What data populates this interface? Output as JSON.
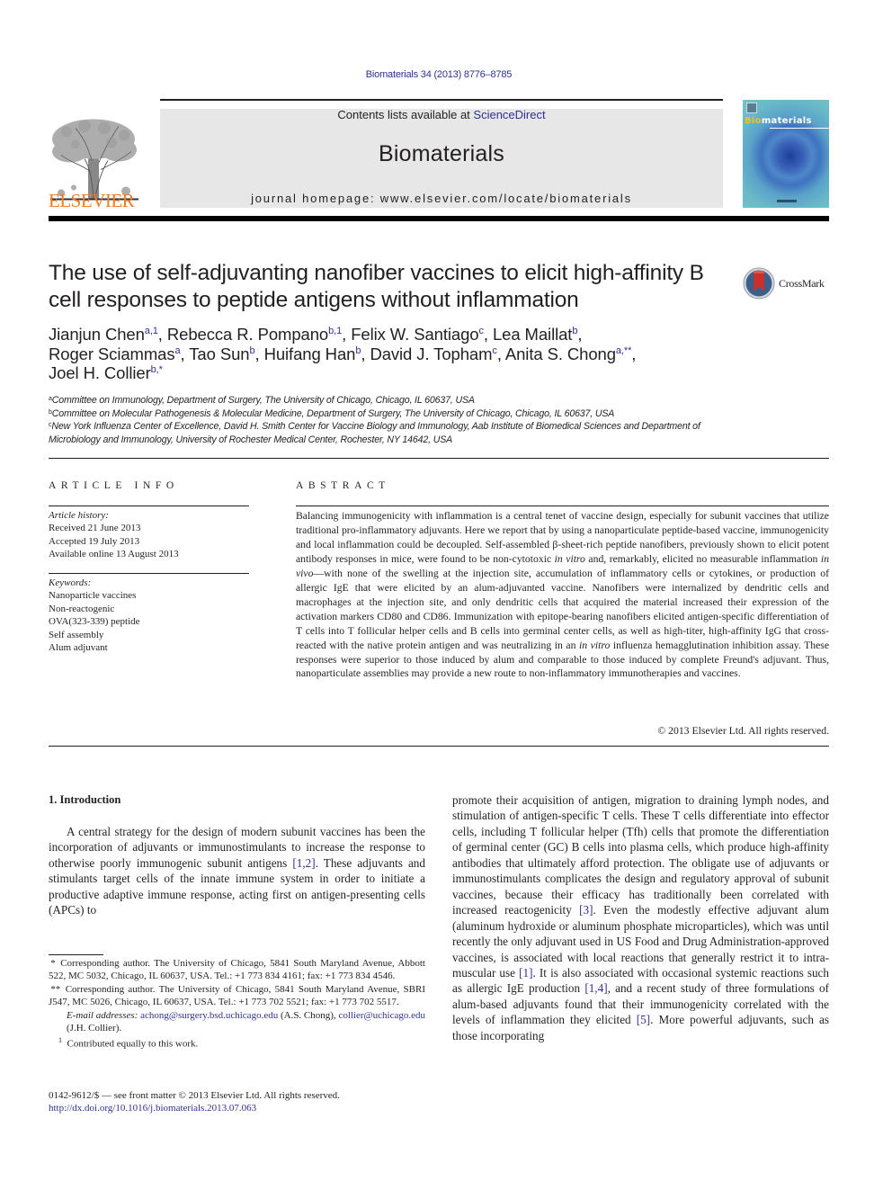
{
  "header": {
    "journal_ref": "Biomaterials 34 (2013) 8776–8785",
    "contents_prefix": "Contents lists available at ",
    "contents_link": "ScienceDirect",
    "journal_name": "Biomaterials",
    "homepage": "journal homepage: www.elsevier.com/locate/biomaterials",
    "publisher_logo_text": "ELSEVIER",
    "cover_title_highlight": "Bio",
    "cover_title_rest": "materials",
    "colors": {
      "publisher_orange": "#f47b20",
      "link_blue": "#2e3192",
      "masthead_gray": "#e7e7e7"
    }
  },
  "article": {
    "title": "The use of self-adjuvanting nanofiber vaccines to elicit high-affinity B cell responses to peptide antigens without inflammation",
    "crossmark_label": "CrossMark",
    "authors": [
      {
        "name": "Jianjun Chen",
        "sup": "a,1",
        "sep": ", "
      },
      {
        "name": "Rebecca R. Pompano",
        "sup": "b,1",
        "sep": ", "
      },
      {
        "name": "Felix W. Santiago",
        "sup": "c",
        "sep": ", "
      },
      {
        "name": "Lea Maillat",
        "sup": "b",
        "sep": ","
      },
      {
        "name": "Roger Sciammas",
        "sup": "a",
        "sep": ", "
      },
      {
        "name": "Tao Sun",
        "sup": "b",
        "sep": ", "
      },
      {
        "name": "Huifang Han",
        "sup": "b",
        "sep": ", "
      },
      {
        "name": "David J. Topham",
        "sup": "c",
        "sep": ", "
      },
      {
        "name": "Anita S. Chong",
        "sup": "a,**",
        "sep": ","
      },
      {
        "name": "Joel H. Collier",
        "sup": "b,*",
        "sep": ""
      }
    ],
    "affiliations": [
      {
        "key": "a",
        "text": "Committee on Immunology, Department of Surgery, The University of Chicago, Chicago, IL 60637, USA"
      },
      {
        "key": "b",
        "text": "Committee on Molecular Pathogenesis & Molecular Medicine, Department of Surgery, The University of Chicago, Chicago, IL 60637, USA"
      },
      {
        "key": "c",
        "text": "New York Influenza Center of Excellence, David H. Smith Center for Vaccine Biology and Immunology, Aab Institute of Biomedical Sciences and Department of Microbiology and Immunology, University of Rochester Medical Center, Rochester, NY 14642, USA"
      }
    ]
  },
  "article_info": {
    "heading": "ARTICLE INFO",
    "history_label": "Article history:",
    "history": [
      "Received 21 June 2013",
      "Accepted 19 July 2013",
      "Available online 13 August 2013"
    ],
    "keywords_label": "Keywords:",
    "keywords": [
      "Nanoparticle vaccines",
      "Non-reactogenic",
      "OVA(323-339) peptide",
      "Self assembly",
      "Alum adjuvant"
    ]
  },
  "abstract": {
    "heading": "ABSTRACT",
    "segments": [
      {
        "t": "Balancing immunogenicity with inflammation is a central tenet of vaccine design, especially for subunit vaccines that utilize traditional pro-inflammatory adjuvants. Here we report that by using a nano­particulate peptide-based vaccine, immunogenicity and local inflammation could be decoupled. Self-assembled β-sheet-rich peptide nanofibers, previously shown to elicit potent antibody responses in mice, were found to be non-cytotoxic ",
        "i": false
      },
      {
        "t": "in vitro",
        "i": true
      },
      {
        "t": " and, remarkably, elicited no measurable inflammation ",
        "i": false
      },
      {
        "t": "in vivo",
        "i": true
      },
      {
        "t": "—with none of the swelling at the injection site, accumulation of inflammatory cells or cytokines, or production of allergic IgE that were elicited by an alum-adjuvanted vaccine. Nanofibers were inter­nalized by dendritic cells and macrophages at the injection site, and only dendritic cells that acquired the material increased their expression of the activation markers CD80 and CD86. Immunization with epitope-bearing nanofibers elicited antigen-specific differentiation of T cells into T follicular helper cells and B cells into germinal center cells, as well as high-titer, high-affinity IgG that cross-reacted with the native protein antigen and was neutralizing in an ",
        "i": false
      },
      {
        "t": "in vitro",
        "i": true
      },
      {
        "t": " influenza hemagglutination inhibition assay. These responses were superior to those induced by alum and comparable to those induced by complete Freund's adjuvant. Thus, nanoparticulate assemblies may provide a new route to non-inflammatory immunotherapies and vaccines.",
        "i": false
      }
    ],
    "copyright": "© 2013 Elsevier Ltd. All rights reserved."
  },
  "body": {
    "section_heading": "1.  Introduction",
    "left_segments": [
      {
        "t": "A central strategy for the design of modern subunit vaccines has been the incorporation of adjuvants or immunostimulants to in­crease the response to otherwise poorly immunogenic subunit antigens ",
        "c": false
      },
      {
        "t": "[1,2]",
        "c": true
      },
      {
        "t": ". These adjuvants and stimulants target cells of the innate immune system in order to initiate a productive adaptive immune response, acting first on antigen-presenting cells (APCs) to",
        "c": false
      }
    ],
    "right_segments": [
      {
        "t": "promote their acquisition of antigen, migration to draining lymph nodes, and stimulation of antigen-specific T cells. These T cells differentiate into effector cells, including T follicular helper (Tfh) cells that promote the differentiation of germinal center (GC) B cells into plasma cells, which produce high-affinity antibodies that ultimately afford protection. The obligate use of adjuvants or immunostimulants complicates the design and regulatory approval of subunit vaccines, because their efficacy has traditionally been correlated with increased reactogenicity ",
        "c": false
      },
      {
        "t": "[3]",
        "c": true
      },
      {
        "t": ". Even the modestly effective adjuvant alum (aluminum hydroxide or aluminum phos­phate microparticles), which was until recently the only adjuvant used in US Food and Drug Administration-approved vaccines, is associated with local reactions that generally restrict it to intra­muscular use ",
        "c": false
      },
      {
        "t": "[1]",
        "c": true
      },
      {
        "t": ". It is also associated with occasional systemic re­actions such as allergic IgE production ",
        "c": false
      },
      {
        "t": "[1,4]",
        "c": true
      },
      {
        "t": ", and a recent study of three formulations of alum-based adjuvants found that their immunogenicity correlated with the levels of inflammation they elicited ",
        "c": false
      },
      {
        "t": "[5]",
        "c": true
      },
      {
        "t": ". More powerful adjuvants, such as those incorporating",
        "c": false
      }
    ]
  },
  "footnotes": {
    "corr1": " * Corresponding author. The University of Chicago, 5841 South Maryland Avenue, Abbott 522, MC 5032, Chicago, IL 60637, USA. Tel.: +1 773 834 4161; fax: +1 773 834 4546.",
    "corr2": " ** Corresponding author. The University of Chicago, 5841 South Maryland Avenue, SBRI J547, MC 5026, Chicago, IL 60637, USA. Tel.: +1 773 702 5521; fax: +1 773 702 5517.",
    "email_label": "E-mail addresses:",
    "email1": "achong@surgery.bsd.uchicago.edu",
    "email1_owner": " (A.S. Chong), ",
    "email2": "collier@uchicago.edu",
    "email2_owner": " (J.H. Collier).",
    "equal_contrib_mark": "1",
    "equal_contrib": "Contributed equally to this work."
  },
  "front_matter": {
    "issn_line": "0142-9612/$ — see front matter © 2013 Elsevier Ltd. All rights reserved.",
    "doi": "http://dx.doi.org/10.1016/j.biomaterials.2013.07.063"
  }
}
